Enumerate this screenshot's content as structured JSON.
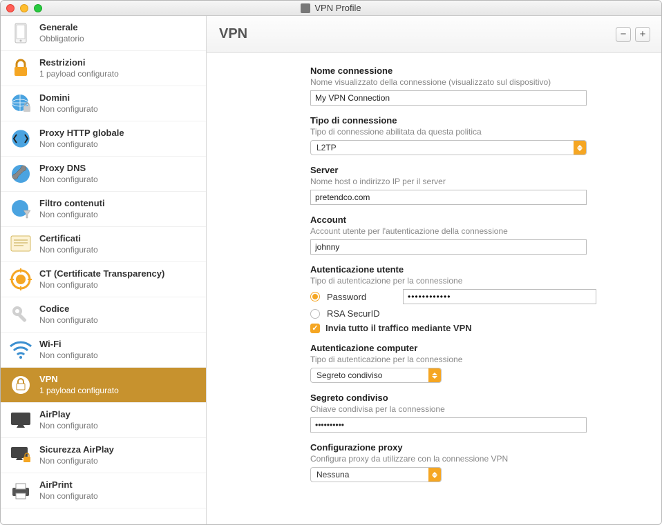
{
  "window": {
    "title": "VPN Profile"
  },
  "sidebar": {
    "items": [
      {
        "title": "Generale",
        "subtitle": "Obbligatorio",
        "icon": "general"
      },
      {
        "title": "Restrizioni",
        "subtitle": "1 payload configurato",
        "icon": "lock"
      },
      {
        "title": "Domini",
        "subtitle": "Non configurato",
        "icon": "globe-lock"
      },
      {
        "title": "Proxy HTTP globale",
        "subtitle": "Non configurato",
        "icon": "globe-arrows"
      },
      {
        "title": "Proxy DNS",
        "subtitle": "Non configurato",
        "icon": "wrench"
      },
      {
        "title": "Filtro contenuti",
        "subtitle": "Non configurato",
        "icon": "globe-funnel"
      },
      {
        "title": "Certificati",
        "subtitle": "Non configurato",
        "icon": "cert"
      },
      {
        "title": "CT (Certificate Transparency)",
        "subtitle": "Non configurato",
        "icon": "ct"
      },
      {
        "title": "Codice",
        "subtitle": "Non configurato",
        "icon": "key"
      },
      {
        "title": "Wi-Fi",
        "subtitle": "Non configurato",
        "icon": "wifi"
      },
      {
        "title": "VPN",
        "subtitle": "1 payload configurato",
        "icon": "vpn",
        "selected": true
      },
      {
        "title": "AirPlay",
        "subtitle": "Non configurato",
        "icon": "airplay"
      },
      {
        "title": "Sicurezza AirPlay",
        "subtitle": "Non configurato",
        "icon": "airplay-lock"
      },
      {
        "title": "AirPrint",
        "subtitle": "Non configurato",
        "icon": "printer"
      }
    ]
  },
  "main": {
    "title": "VPN",
    "remove_btn": "−",
    "add_btn": "+",
    "fields": {
      "connection_name": {
        "label": "Nome connessione",
        "desc": "Nome visualizzato della connessione (visualizzato sul dispositivo)",
        "value": "My VPN Connection"
      },
      "connection_type": {
        "label": "Tipo di connessione",
        "desc": "Tipo di connessione abilitata da questa politica",
        "value": "L2TP"
      },
      "server": {
        "label": "Server",
        "desc": "Nome host o indirizzo IP per il server",
        "value": "pretendco.com"
      },
      "account": {
        "label": "Account",
        "desc": "Account utente per l'autenticazione della connessione",
        "value": "johnny"
      },
      "user_auth": {
        "label": "Autenticazione utente",
        "desc": "Tipo di autenticazione per la connessione",
        "option_password": "Password",
        "option_rsa": "RSA SecurID",
        "password_value": "••••••••••••"
      },
      "send_all_traffic": {
        "label": "Invia tutto il traffico mediante VPN"
      },
      "machine_auth": {
        "label": "Autenticazione computer",
        "desc": "Tipo di autenticazione per la connessione",
        "value": "Segreto condiviso"
      },
      "shared_secret": {
        "label": "Segreto condiviso",
        "desc": "Chiave condivisa per la connessione",
        "value": "••••••••••"
      },
      "proxy": {
        "label": "Configurazione proxy",
        "desc": "Configura proxy da utilizzare con la connessione VPN",
        "value": "Nessuna"
      }
    }
  }
}
